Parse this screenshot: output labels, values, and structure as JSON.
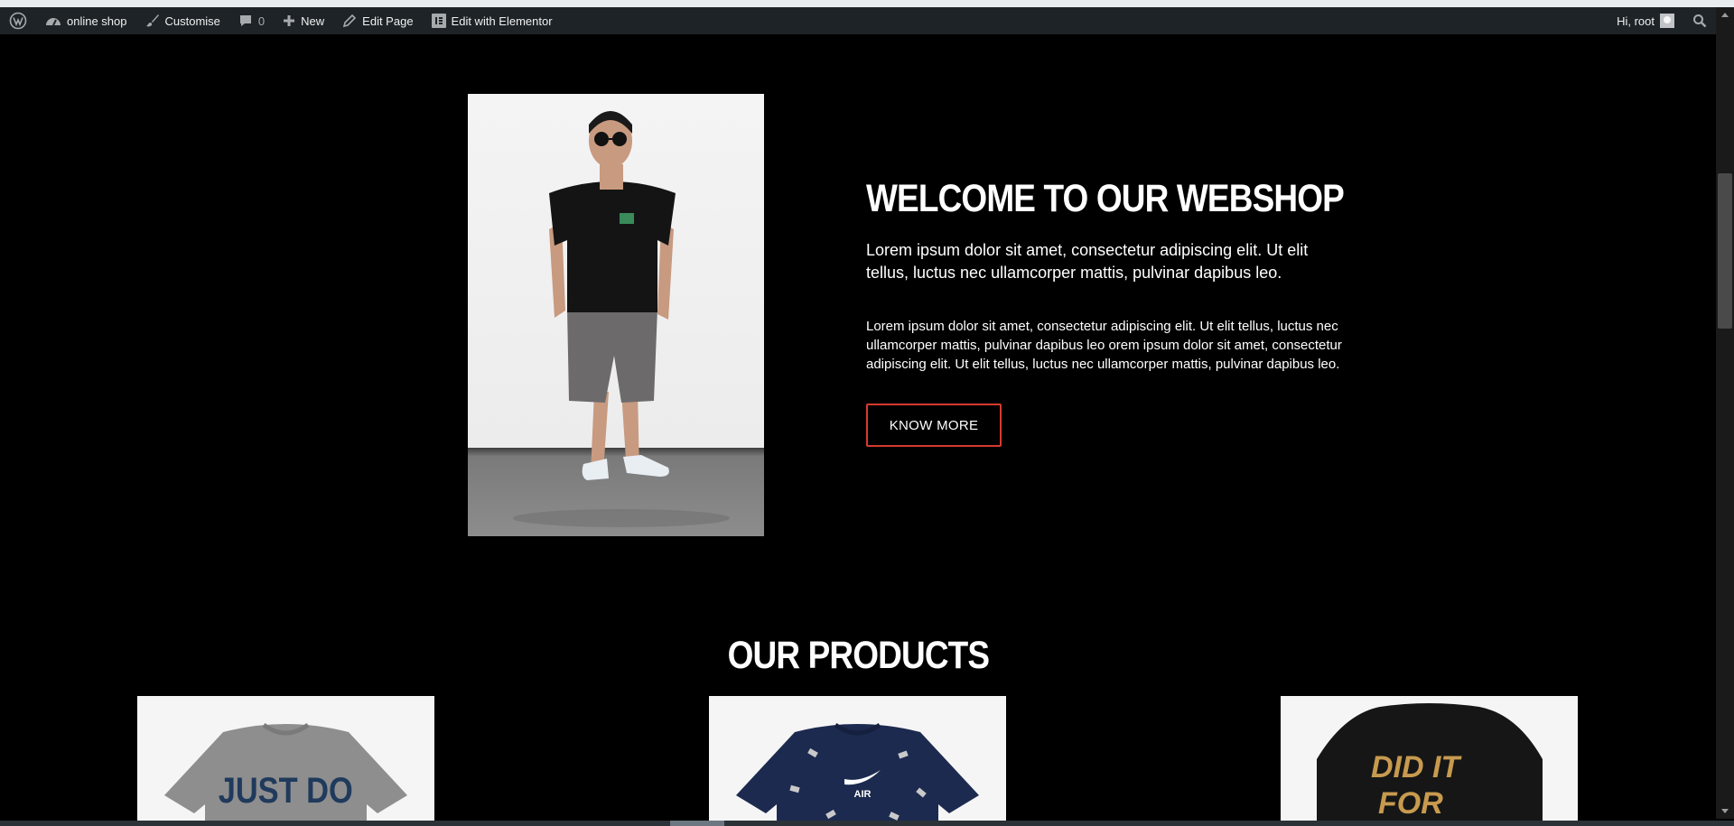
{
  "admin_bar": {
    "site_name": "online shop",
    "customise": "Customise",
    "comments_count": "0",
    "new": "New",
    "edit_page": "Edit Page",
    "edit_elementor": "Edit with Elementor",
    "greeting": "Hi, root"
  },
  "hero": {
    "title": "WELCOME TO OUR WEBSHOP",
    "lead": "Lorem ipsum dolor sit amet, consectetur adipiscing elit. Ut elit tellus, luctus nec ullamcorper mattis, pulvinar dapibus leo.",
    "body": "Lorem ipsum dolor sit amet, consectetur adipiscing elit. Ut elit tellus, luctus nec ullamcorper mattis, pulvinar dapibus leo orem ipsum dolor sit amet, consectetur adipiscing elit. Ut elit tellus, luctus nec ullamcorper mattis, pulvinar dapibus leo.",
    "button": "KNOW MORE"
  },
  "products": {
    "title": "OUR PRODUCTS",
    "items": [
      {
        "print": "JUST DO",
        "shirt_color": "#8e8e8e",
        "print_color": "#1f3a5c"
      },
      {
        "print": "AIR",
        "shirt_color": "#1c2a4f",
        "print_color": "#ffffff"
      },
      {
        "print": "DID IT FOR",
        "shirt_color": "#161616",
        "print_color": "#c79a4e"
      }
    ]
  },
  "colors": {
    "background": "#000000",
    "admin_bar": "#1d2327",
    "accent": "#d63a2f"
  }
}
